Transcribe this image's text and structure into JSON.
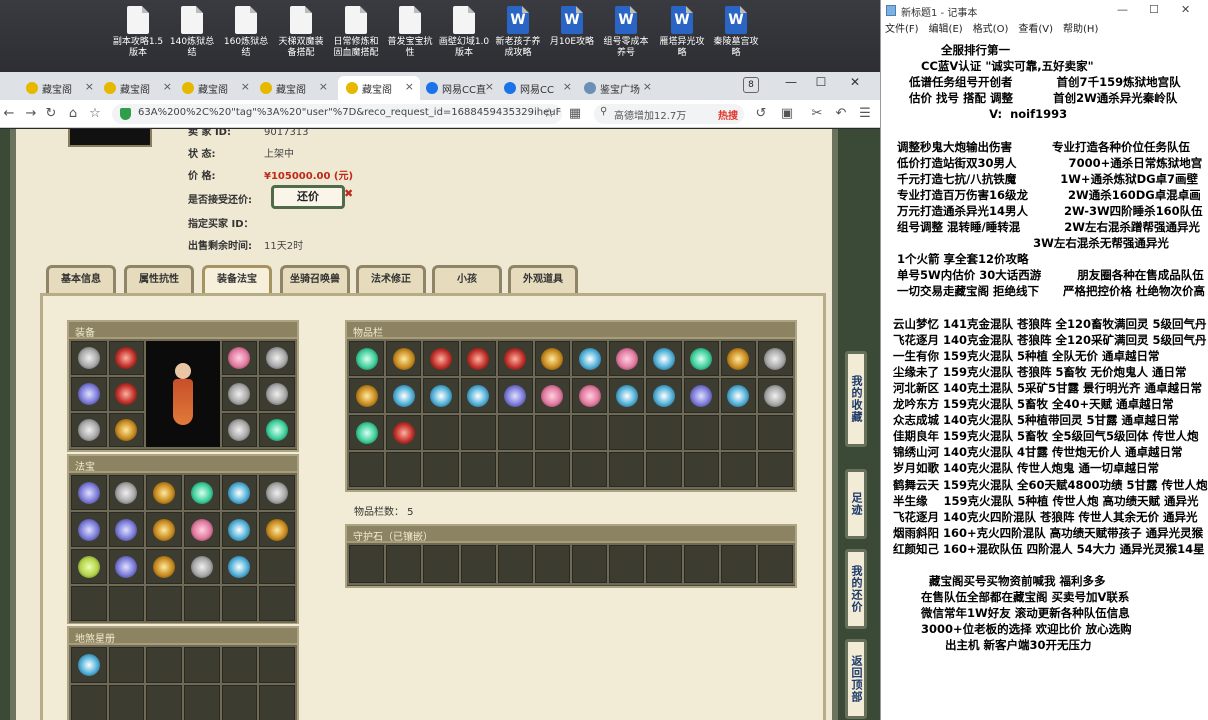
{
  "desktop": {
    "icons": [
      {
        "label": "副本攻略1.5版本",
        "kind": "doc"
      },
      {
        "label": "140炼狱总结",
        "kind": "doc"
      },
      {
        "label": "160炼狱总结",
        "kind": "doc"
      },
      {
        "label": "天梯双魔装备搭配",
        "kind": "doc"
      },
      {
        "label": "日常修炼和固血魔搭配",
        "kind": "doc"
      },
      {
        "label": "普发宝宝抗性",
        "kind": "doc"
      },
      {
        "label": "画壁幻域1.0版本",
        "kind": "doc"
      },
      {
        "label": "新老孩子养成攻略",
        "kind": "word"
      },
      {
        "label": "月10E攻略",
        "kind": "word"
      },
      {
        "label": "组号零成本养号",
        "kind": "word"
      },
      {
        "label": "雁塔异光攻略",
        "kind": "word"
      },
      {
        "label": "秦陵墓宫攻略",
        "kind": "word"
      }
    ]
  },
  "browser": {
    "tabs": [
      {
        "label": "藏宝阁",
        "icon": "treasure-icon"
      },
      {
        "label": "藏宝阁",
        "icon": "treasure-icon"
      },
      {
        "label": "藏宝阁",
        "icon": "treasure-icon"
      },
      {
        "label": "藏宝阁",
        "icon": "treasure-icon"
      },
      {
        "label": "藏宝阁",
        "icon": "treasure-icon",
        "active": true
      },
      {
        "label": "网易CC直",
        "icon": "cc-icon"
      },
      {
        "label": "网易CC",
        "icon": "cc-icon"
      },
      {
        "label": "鉴宝广场",
        "icon": "globe-icon"
      }
    ],
    "tab_count": "8",
    "url": "63A%200%2C%20\"tag\"%3A%20\"user\"%7D&reco_request_id=1688459435329iheuF",
    "search_placeholder": "高德增加12.7万",
    "search_hot": "热搜"
  },
  "listing": {
    "rows": [
      {
        "label": "卖 家   ID:",
        "value": "9017313"
      },
      {
        "label": "状      态:",
        "value": "上架中"
      },
      {
        "label": "价      格:",
        "value": "¥105000.00 (元)"
      },
      {
        "label": "是否接受还价:",
        "value": ""
      },
      {
        "label": "指定买家 ID：",
        "value": ""
      },
      {
        "label": "出售剩余时间:",
        "value": "11天2时"
      }
    ],
    "counter_offer": "还价"
  },
  "panel_tabs": [
    {
      "label": "基本信息"
    },
    {
      "label": "属性抗性"
    },
    {
      "label": "装备法宝",
      "active": true
    },
    {
      "label": "坐骑召唤兽"
    },
    {
      "label": "法术修正"
    },
    {
      "label": "小孩"
    },
    {
      "label": "外观道具"
    }
  ],
  "sections": {
    "equipment": "装备",
    "fabao": "法宝",
    "earth_book": "地煞星册",
    "inventory": "物品栏",
    "slot_count": "物品栏数：  5",
    "guard_stone": "守护石（已镶嵌）"
  },
  "side_buttons": [
    {
      "label": "我的收藏"
    },
    {
      "label": "足迹"
    },
    {
      "label": "我的还价"
    },
    {
      "label": "返回顶部"
    }
  ],
  "notepad": {
    "title": "新标题1 - 记事本",
    "menu": [
      "文件(F)",
      "编辑(E)",
      "格式(O)",
      "查看(V)",
      "帮助(H)"
    ],
    "text": "              全服排行第一\n         CC蓝V认证 \"诚实可靠,五好卖家\"\n      低谱任务组号开创者           首创7千159炼狱地宫队\n      估价 找号 搭配 调整          首创2W通杀异光秦岭队\n                          V:  noif1993\n\n   调整秒鬼大炮输出伤害          专业打造各种价位任务队伍\n   低价打造站街双30男人             7000+通杀日常炼狱地宫\n   千元打造七抗/八抗铁魔           1W+通杀炼狱DG卓7画壁\n   专业打造百万伤害16级龙          2W通杀160DG卓混卓画\n   万元打造通杀异光14男人         2W-3W四阶睡杀160队伍\n   组号调整 混转睡/睡转混           2W左右混杀蹭帮强通异光\n                                     3W左右混杀无帮强通异光\n   1个火箭 享全套12价攻略\n   单号5W内估价 30大话西游         朋友圈各种在售成品队伍\n   一切交易走藏宝阁 拒绝线下      严格把控价格 杜绝物次价高\n\n  云山梦忆 141克金混队 苍狼阵 全120畜牧满回灵 5级回气丹\n  飞花逐月 140克金混队 苍狼阵 全120采矿满回灵 5级回气丹\n  一生有你 159克火混队 5种植 全队无价 通卓越日常\n  尘缘未了 159克火混队 苍狼阵 5畜牧 无价炮鬼人 通日常\n  河北新区 140克土混队 5采矿5甘露 景行明光齐 通卓越日常\n  龙吟东方 159克火混队 5畜牧 全40+天赋 通卓越日常\n  众志成城 140克火混队 5种植带回灵 5甘露 通卓越日常\n  佳期良年 159克火混队 5畜牧 全5级回气5级回体 传世人炮\n  锦绣山河 140克火混队 4甘露 传世炮无价人 通卓越日常\n  岁月如歌 140克火混队 传世人炮鬼 通一切卓越日常\n  鹤舞云天 159克火混队 全60天赋4800功绩 5甘露 传世人炮\n  半生缘    159克火混队 5种植 传世人炮 高功绩天赋 通异光\n  飞花逐月 140克火四阶混队 苍狼阵 传世人其余无价 通异光\n  烟雨斜阳 160+克火四阶混队 高功绩天赋带孩子 通异光灵猴\n  红颜知己 160+混砍队伍 四阶混人 54大力 通异光灵猴14星\n\n           藏宝阁买号买物资前喊我 福利多多\n         在售队伍全部都在藏宝阁 买卖号加V联系\n         微信常年1W好友 滚动更新各种队伍信息\n         3000+位老板的选择 欢迎比价 放心选购\n               出主机 新客户端30开无压力"
  }
}
